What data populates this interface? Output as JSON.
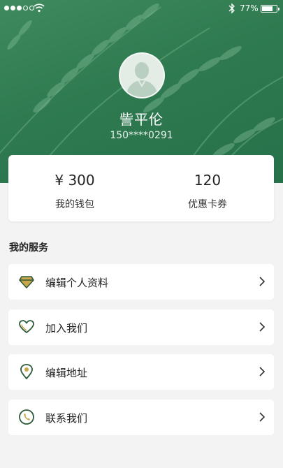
{
  "status_bar": {
    "battery_text": "77%",
    "battery_level": 0.77,
    "signal_dots_filled": 3,
    "signal_dots_total": 5
  },
  "profile": {
    "name": "訾平伦",
    "phone": "150****0291"
  },
  "stats": {
    "wallet": {
      "value": "¥ 300",
      "label": "我的钱包"
    },
    "coupons": {
      "value": "120",
      "label": "优惠卡券"
    }
  },
  "services": {
    "title": "我的服务",
    "items": [
      {
        "label": "编辑个人资料",
        "icon": "diamond-icon"
      },
      {
        "label": "加入我们",
        "icon": "heart-icon"
      },
      {
        "label": "编辑地址",
        "icon": "location-pin-icon"
      },
      {
        "label": "联系我们",
        "icon": "phone-icon"
      }
    ]
  },
  "colors": {
    "brand_green": "#2f7a50",
    "icon_green": "#2d5a3a",
    "icon_accent": "#c9a64a",
    "background": "#f3f3f3"
  }
}
